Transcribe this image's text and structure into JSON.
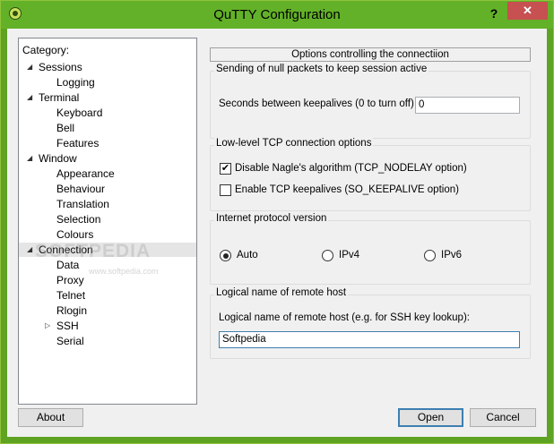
{
  "window": {
    "title": "QuTTY Configuration",
    "help_label": "?",
    "close_label": "✕",
    "accent": "#63b128"
  },
  "tree": {
    "header": "Category:",
    "items": [
      {
        "label": "Sessions",
        "level": 0,
        "expanded": true
      },
      {
        "label": "Logging",
        "level": 1
      },
      {
        "label": "Terminal",
        "level": 0,
        "expanded": true
      },
      {
        "label": "Keyboard",
        "level": 1
      },
      {
        "label": "Bell",
        "level": 1
      },
      {
        "label": "Features",
        "level": 1
      },
      {
        "label": "Window",
        "level": 0,
        "expanded": true
      },
      {
        "label": "Appearance",
        "level": 1
      },
      {
        "label": "Behaviour",
        "level": 1
      },
      {
        "label": "Translation",
        "level": 1
      },
      {
        "label": "Selection",
        "level": 1
      },
      {
        "label": "Colours",
        "level": 1
      },
      {
        "label": "Connection",
        "level": 0,
        "expanded": true,
        "selected": true
      },
      {
        "label": "Data",
        "level": 1
      },
      {
        "label": "Proxy",
        "level": 1
      },
      {
        "label": "Telnet",
        "level": 1
      },
      {
        "label": "Rlogin",
        "level": 1
      },
      {
        "label": "SSH",
        "level": 1,
        "collapsed": true
      },
      {
        "label": "Serial",
        "level": 1
      }
    ],
    "watermark": "SOFTPEDIA",
    "watermark_sub": "www.softpedia.com"
  },
  "panel": {
    "title": "Options controlling the connectiion",
    "keepalive": {
      "group_label": "Sending of null packets to keep session active",
      "field_label": "Seconds between keepalives (0 to turn off)",
      "value": "0"
    },
    "tcp": {
      "group_label": "Low-level TCP connection options",
      "nagle_label": "Disable Nagle's algorithm (TCP_NODELAY option)",
      "nagle_checked": true,
      "keepalive_label": "Enable TCP keepalives (SO_KEEPALIVE option)",
      "keepalive_checked": false
    },
    "ip": {
      "group_label": "Internet protocol version",
      "options": [
        "Auto",
        "IPv4",
        "IPv6"
      ],
      "selected": "Auto"
    },
    "hostname": {
      "group_label": "Logical name of remote host",
      "field_label": "Logical name of remote host (e.g. for SSH key lookup):",
      "value": "Softpedia"
    }
  },
  "buttons": {
    "about": "About",
    "open": "Open",
    "cancel": "Cancel"
  }
}
